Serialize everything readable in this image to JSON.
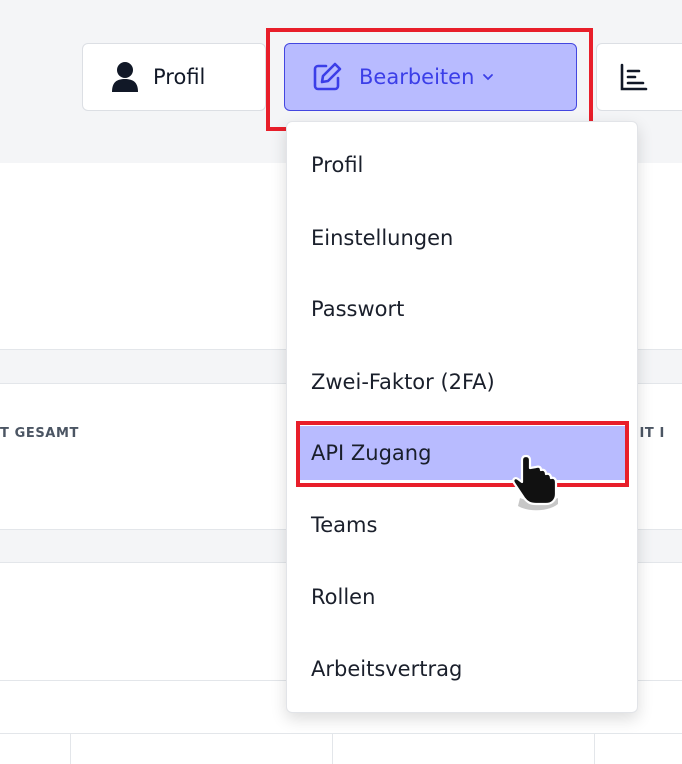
{
  "toolbar": {
    "profil_label": "Profil",
    "edit_label": "Bearbeiten",
    "icons": {
      "profil": "user-icon",
      "edit": "pencil-square-icon",
      "dropdown": "chevron-down-icon",
      "report": "bar-chart-icon",
      "cursor": "hand-pointer-icon"
    }
  },
  "background": {
    "col_left": "T GESAMT",
    "col_right": "EIT I"
  },
  "dropdown": {
    "items": [
      {
        "label": "Profil"
      },
      {
        "label": "Einstellungen"
      },
      {
        "label": "Passwort"
      },
      {
        "label": "Zwei-Faktor (2FA)"
      },
      {
        "label": "API Zugang",
        "active": true
      },
      {
        "label": "Teams"
      },
      {
        "label": "Rollen"
      },
      {
        "label": "Arbeitsvertrag"
      }
    ]
  },
  "colors": {
    "accent": "#3b3ee8",
    "active_bg": "#b8bbff",
    "highlight": "#e81e2a"
  }
}
